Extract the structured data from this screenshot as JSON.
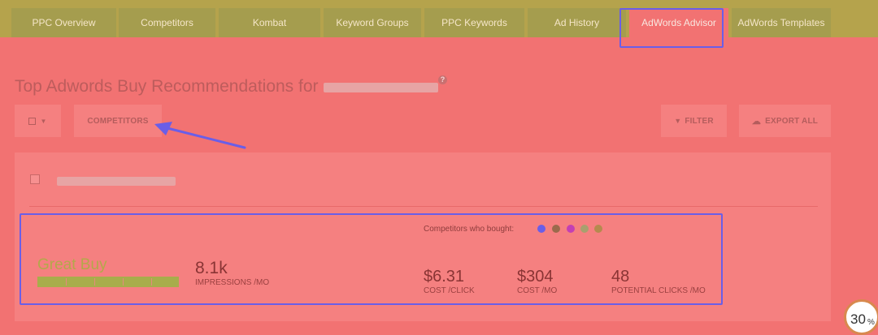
{
  "tabs": [
    {
      "label": "PPC Overview"
    },
    {
      "label": "Competitors"
    },
    {
      "label": "Kombat"
    },
    {
      "label": "Keyword Groups"
    },
    {
      "label": "PPC Keywords"
    },
    {
      "label": "Ad History"
    },
    {
      "label": "AdWords Advisor"
    },
    {
      "label": "AdWords Templates"
    }
  ],
  "active_tab": "AdWords Advisor",
  "title": "Top Adwords Buy Recommendations for",
  "toolbar": {
    "competitors_label": "COMPETITORS",
    "filter_label": "FILTER",
    "export_label": "EXPORT ALL"
  },
  "offer": {
    "rating": "Great Buy",
    "rating_level": 1.0,
    "impressions_value": "8.1k",
    "impressions_label": "IMPRESSIONS /MO",
    "competitors_label": "Competitors who bought:",
    "competitor_colors": [
      "#6a5ee8",
      "#9b6a4c",
      "#c33fb4",
      "#a8a06e",
      "#b58a4e"
    ],
    "cost_click_value": "$6.31",
    "cost_click_label": "COST /CLICK",
    "cost_mo_value": "$304",
    "cost_mo_label": "COST /MO",
    "clicks_value": "48",
    "clicks_label": "POTENTIAL CLICKS /MO"
  },
  "badge": {
    "value": "30",
    "unit": "%"
  },
  "colors": {
    "background": "#f27272",
    "tabbar": "#b5a34c",
    "highlight": "#6a5ee8",
    "rating": "#b4a84a"
  }
}
